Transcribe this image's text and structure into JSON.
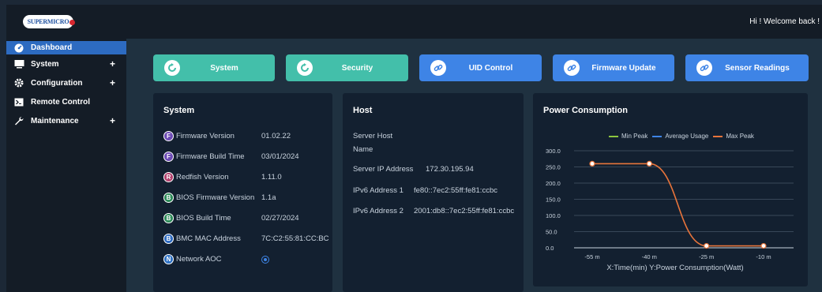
{
  "header": {
    "logo_text": "SUPERMICRO",
    "welcome": "Hi ! Welcome back !"
  },
  "sidebar": {
    "items": [
      {
        "label": "Dashboard",
        "icon": "dashboard-icon",
        "active": true,
        "expandable": false
      },
      {
        "label": "System",
        "icon": "monitor-icon",
        "active": false,
        "expandable": true
      },
      {
        "label": "Configuration",
        "icon": "gear-icon",
        "active": false,
        "expandable": true
      },
      {
        "label": "Remote Control",
        "icon": "terminal-icon",
        "active": false,
        "expandable": false
      },
      {
        "label": "Maintenance",
        "icon": "wrench-icon",
        "active": false,
        "expandable": true
      }
    ],
    "expand_symbol": "+"
  },
  "quick_links": [
    {
      "label": "System",
      "icon": "refresh-icon",
      "color": "#43bfaa"
    },
    {
      "label": "Security",
      "icon": "refresh-icon",
      "color": "#43bfaa"
    },
    {
      "label": "UID Control",
      "icon": "link-icon",
      "color": "#3e84e6"
    },
    {
      "label": "Firmware Update",
      "icon": "link-icon",
      "color": "#3e84e6"
    },
    {
      "label": "Sensor Readings",
      "icon": "link-icon",
      "color": "#3e84e6"
    }
  ],
  "system_card": {
    "title": "System",
    "rows": [
      {
        "badge": "F",
        "label": "Firmware Version",
        "value": "01.02.22"
      },
      {
        "badge": "F",
        "label": "Firmware Build Time",
        "value": "03/01/2024"
      },
      {
        "badge": "R",
        "label": "Redfish Version",
        "value": "1.11.0"
      },
      {
        "badge": "B",
        "label": "BIOS Firmware Version",
        "value": "1.1a"
      },
      {
        "badge": "B",
        "label": "BIOS Build Time",
        "value": "02/27/2024"
      },
      {
        "badge": "B",
        "label": "BMC MAC Address",
        "value": "7C:C2:55:81:CC:BC"
      },
      {
        "badge": "N",
        "label": "Network AOC",
        "value": ""
      }
    ]
  },
  "host_card": {
    "title": "Host",
    "server_host_label_1": "Server Host",
    "server_host_label_2": "Name",
    "ip_label": "Server IP Address",
    "ip_value": "172.30.195.94",
    "ipv6_1_label": "IPv6 Address 1",
    "ipv6_1_value": "fe80::7ec2:55ff:fe81:ccbc",
    "ipv6_2_label": "IPv6 Address 2",
    "ipv6_2_value": "2001:db8::7ec2:55ff:fe81:ccbc"
  },
  "power_card": {
    "title": "Power Consumption"
  },
  "chart_data": {
    "type": "line",
    "title": "Power Consumption",
    "xlabel": "X:Time(min) Y:Power Consumption(Watt)",
    "ylabel": "",
    "categories": [
      "-55 m",
      "-40 m",
      "-25 m",
      "-10 m"
    ],
    "yticks": [
      "0.0",
      "50.0",
      "100.0",
      "150.0",
      "200.0",
      "250.0",
      "300.0"
    ],
    "ylim": [
      0,
      300
    ],
    "legend_position": "top",
    "series": [
      {
        "name": "Min Peak",
        "color": "#8cc63f",
        "values": []
      },
      {
        "name": "Average Usage",
        "color": "#3e84e6",
        "values": []
      },
      {
        "name": "Max Peak",
        "color": "#e8743b",
        "values": [
          260,
          260,
          6,
          6
        ]
      }
    ]
  }
}
